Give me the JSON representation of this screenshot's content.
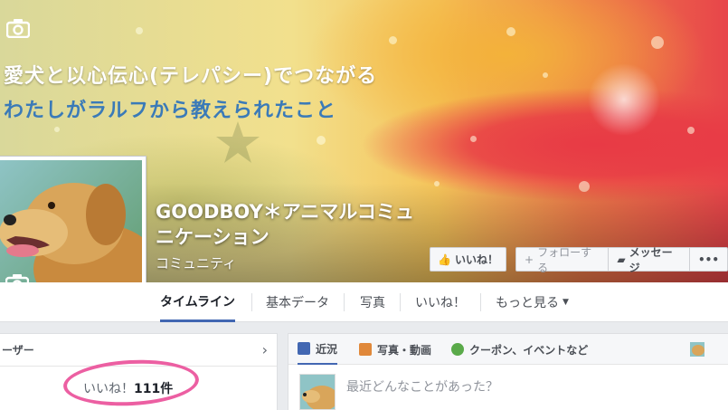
{
  "cover": {
    "tagline_line1": "愛犬と以心伝心(テレパシー)でつながる",
    "tagline_line2": "わたしがラルフから教えられたこと",
    "icons": [
      "camera-icon",
      "star-decoration"
    ]
  },
  "page": {
    "name": "GOODBOY＊アニマルコミュニケーション",
    "category": "コミュニティ"
  },
  "actions": {
    "like_label": "いいね！",
    "follow_label": "フォローする",
    "message_label": "メッセージ",
    "more_label": "•••"
  },
  "nav": {
    "tabs": [
      {
        "label": "タイムライン",
        "active": true
      },
      {
        "label": "基本データ"
      },
      {
        "label": "写真"
      },
      {
        "label": "いいね！"
      },
      {
        "label": "もっと見る"
      }
    ]
  },
  "left_panel": {
    "header_label": "ーザー",
    "likes_prefix": "いいね！",
    "likes_count": "111件"
  },
  "composer": {
    "tabs": [
      {
        "label": "近況",
        "icon": "edit-icon"
      },
      {
        "label": "写真・動画",
        "icon": "photo-icon"
      },
      {
        "label": "クーポン、イベントなど",
        "icon": "offer-icon"
      }
    ],
    "placeholder": "最近どんなことがあった？"
  },
  "colors": {
    "accent": "#4267b2",
    "highlight_circle": "#ec5fa2",
    "tagline_blue": "#3a7ab8"
  }
}
